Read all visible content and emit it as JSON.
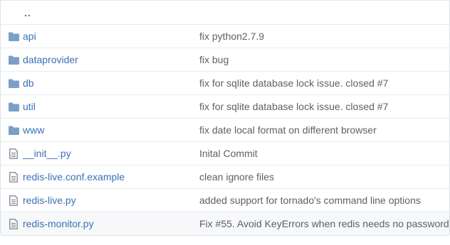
{
  "parent_dir": {
    "label": ".."
  },
  "colors": {
    "link": "#3c70b4",
    "folder_icon": "#7aa0c8",
    "file_icon": "#7d8590",
    "message": "#5d6166"
  },
  "rows": [
    {
      "type": "folder",
      "icon": "folder-icon",
      "name": "api",
      "message": "fix python2.7.9"
    },
    {
      "type": "folder",
      "icon": "folder-icon",
      "name": "dataprovider",
      "message": "fix bug"
    },
    {
      "type": "folder",
      "icon": "folder-icon",
      "name": "db",
      "message": "fix for sqlite database lock issue. closed #7"
    },
    {
      "type": "folder",
      "icon": "folder-icon",
      "name": "util",
      "message": "fix for sqlite database lock issue. closed #7"
    },
    {
      "type": "folder",
      "icon": "folder-icon",
      "name": "www",
      "message": "fix date local format on different browser"
    },
    {
      "type": "file",
      "icon": "file-icon",
      "name": "__init__.py",
      "message": "Inital Commit"
    },
    {
      "type": "file",
      "icon": "file-icon",
      "name": "redis-live.conf.example",
      "message": "clean ignore files"
    },
    {
      "type": "file",
      "icon": "file-icon",
      "name": "redis-live.py",
      "message": "added support for tornado's command line options"
    },
    {
      "type": "file",
      "icon": "file-icon",
      "name": "redis-monitor.py",
      "message": "Fix #55. Avoid KeyErrors when redis needs no password."
    }
  ]
}
